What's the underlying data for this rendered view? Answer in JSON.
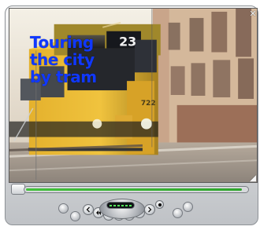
{
  "video": {
    "overlay_lines": [
      "Touring",
      "the city",
      "by tram"
    ],
    "tram_number": "722",
    "tram_sign": "23"
  },
  "player": {
    "progress": 0.98
  },
  "icons": {
    "corner_top_right": "close-icon",
    "corner_bottom_right": "resize-icon"
  },
  "colors": {
    "accent": "#2ea52c",
    "overlay_text": "#1038ff"
  }
}
